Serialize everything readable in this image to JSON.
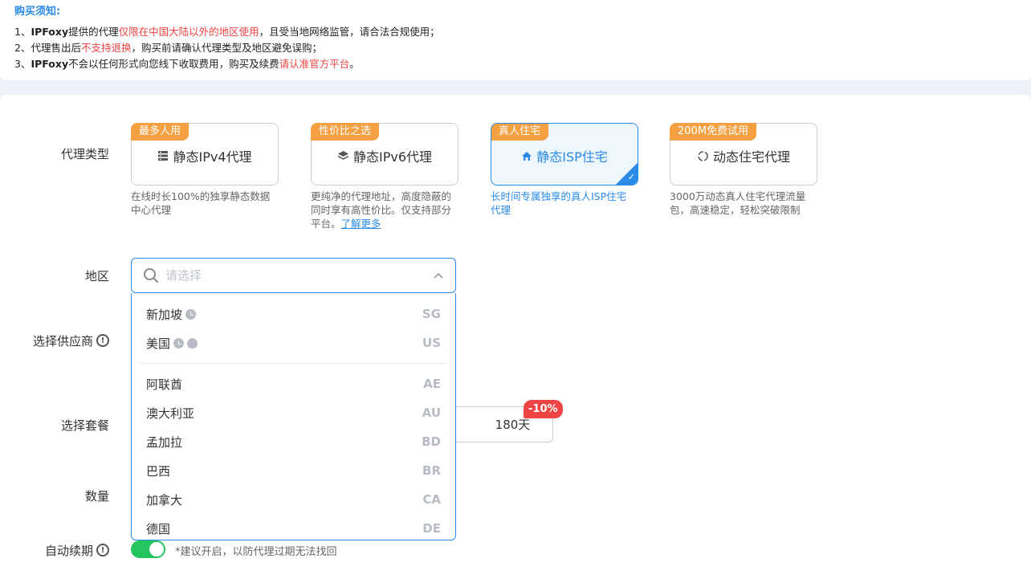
{
  "notice": {
    "title": "购买须知:",
    "line1": {
      "a": "1、",
      "b": "IPFoxy",
      "c": "提供的代理",
      "d": "仅限在中国大陆以外的地区使用",
      "e": "，且受当地网络监管，请合法合规使用；"
    },
    "line2": {
      "a": "2、代理售出后",
      "b": "不支持退换",
      "c": "，购买前请确认代理类型及地区避免误购；"
    },
    "line3": {
      "a": "3、",
      "b": "IPFoxy",
      "c": "不会以任何形式向您线下收取费用，购买及续费",
      "d": "请认准官方平台",
      "e": "。"
    }
  },
  "labels": {
    "proxy_type": "代理类型",
    "region": "地区",
    "provider": "选择供应商",
    "package": "选择套餐",
    "quantity": "数量",
    "auto_renew": "自动续期"
  },
  "proxy_types": [
    {
      "tag": "最多人用",
      "name": "静态IPv4代理",
      "icon": "server-icon",
      "desc": "在线时长100%的独享静态数据中心代理"
    },
    {
      "tag": "性价比之选",
      "name": "静态IPv6代理",
      "icon": "layers-icon",
      "desc": "更纯净的代理地址，高度隐蔽的同时享有高性价比。仅支持部分平台。",
      "link": "了解更多"
    },
    {
      "tag": "真人住宅",
      "name": "静态ISP住宅",
      "icon": "home-icon",
      "desc": "长时间专属独享的真人ISP住宅代理",
      "selected": true
    },
    {
      "tag": "200M免费试用",
      "name": "动态住宅代理",
      "icon": "refresh-icon",
      "desc": "3000万动态真人住宅代理流量包，高速稳定，轻松突破限制"
    }
  ],
  "region": {
    "placeholder": "请选择",
    "featured": [
      {
        "name": "新加坡",
        "code": "SG",
        "icons": [
          "clock-icon"
        ]
      },
      {
        "name": "美国",
        "code": "US",
        "icons": [
          "clock-icon",
          "fire-icon"
        ]
      }
    ],
    "others": [
      {
        "name": "阿联酋",
        "code": "AE"
      },
      {
        "name": "澳大利亚",
        "code": "AU"
      },
      {
        "name": "孟加拉",
        "code": "BD"
      },
      {
        "name": "巴西",
        "code": "BR"
      },
      {
        "name": "加拿大",
        "code": "CA"
      },
      {
        "name": "德国",
        "code": "DE"
      }
    ]
  },
  "package": {
    "label": "180天",
    "discount": "-10%"
  },
  "auto_renew": {
    "on": true,
    "hint": "*建议开启，以防代理过期无法找回"
  },
  "colors": {
    "accent": "#2a8be8",
    "tag": "#f4a043",
    "warning": "#ef4444",
    "toggle_on": "#22c55e"
  }
}
